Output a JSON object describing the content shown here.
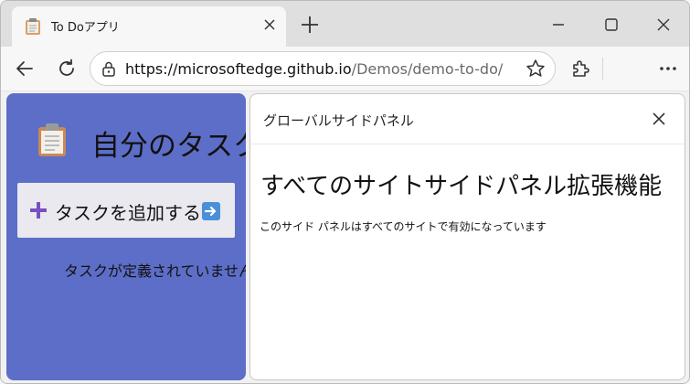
{
  "browser": {
    "tab": {
      "title": "To Doアプリ",
      "favicon": "clipboard-icon"
    },
    "address": {
      "host": "https://microsoftedge.github.io",
      "path": "/Demos/demo-to-do/"
    }
  },
  "app": {
    "title": "自分のタスク",
    "add_button_label": "タスクを追加する",
    "empty_message": "タスクが定義されていません",
    "accent_color": "#5d6ec8"
  },
  "side_panel": {
    "title": "グローバルサイドパネル",
    "heading": "すべてのサイトサイドパネル拡張機能",
    "body": "このサイド パネルはすべてのサイトで有効になっています"
  }
}
